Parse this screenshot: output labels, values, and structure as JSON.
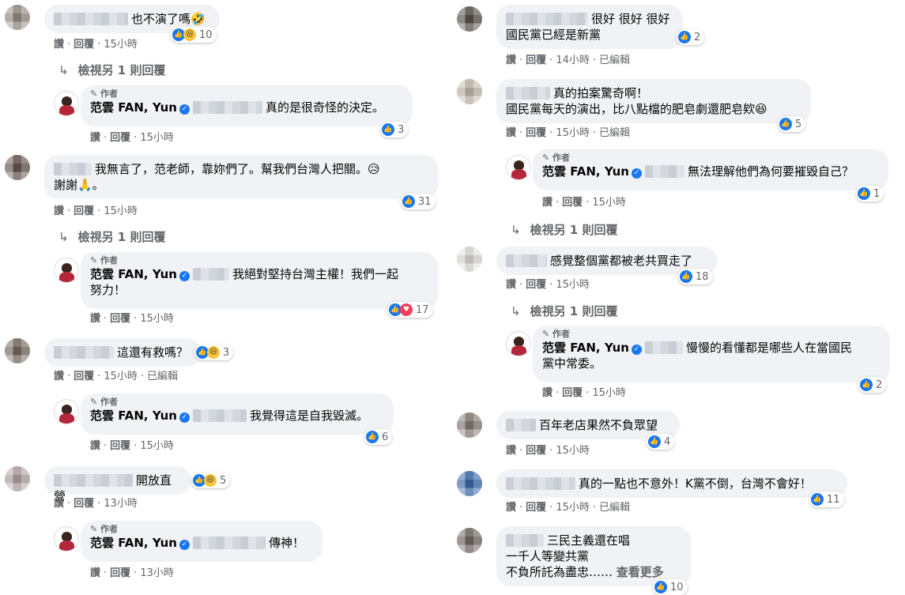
{
  "lbl": {
    "reply": "回覆",
    "like": "讚",
    "edited": "已編輯",
    "author": "作者",
    "fan": "范雲 FAN, Yun",
    "see_more": "查看更多",
    "see_more_reply": "檢視另 1 則回覆"
  },
  "left": [
    {
      "text": "也不演了嗎",
      "emoji": "🤣",
      "like": "讚",
      "reply": "回覆",
      "time": "15小時",
      "count": "10"
    },
    {
      "text": "真的是很奇怪的決定。",
      "time": "15小時",
      "count": "3"
    },
    {
      "text": "我無言了，范老師，靠妳們了。幫我們台灣人把關。😥",
      "text2": "謝謝🙏。",
      "time": "15小時",
      "count": "31"
    },
    {
      "text": "我絕對堅持台灣主權！我們一起",
      "text2": "努力！",
      "time": "15小時",
      "count": "17"
    },
    {
      "text": "這還有救嗎？",
      "time": "15小時",
      "count": "3"
    },
    {
      "text": "我覺得這是自我毀滅。",
      "time": "15小時",
      "count": "6"
    },
    {
      "text": "開放直營",
      "time": "13小時",
      "count": "5"
    },
    {
      "text": "傳神！",
      "time": "13小時"
    }
  ],
  "right": [
    {
      "text": "很好 很好 很好",
      "text2": "國民黨已經是新黨",
      "time": "14小時",
      "count": "2"
    },
    {
      "text": "真的拍案驚奇啊！",
      "text2": "國民黨每天的演出，比八點檔的肥皂劇還肥皂欸😆",
      "time": "15小時",
      "count": "5"
    },
    {
      "text": "無法理解他們為何要摧毀自己？",
      "time": "15小時",
      "count": "1"
    },
    {
      "text": "感覺整個黨都被老共買走了",
      "time": "15小時",
      "count": "18"
    },
    {
      "text": "慢慢的看懂都是哪些人在當國民",
      "text2": "黨中常委。",
      "time": "15小時",
      "count": "2"
    },
    {
      "text": "百年老店果然不負眾望",
      "time": "15小時",
      "count": "4"
    },
    {
      "text": "真的一點也不意外！K黨不倒，台灣不會好！",
      "time": "15小時",
      "count": "11"
    },
    {
      "text": "三民主義還在唱",
      "text2": "一千人等變共黨",
      "text3": "不負所託為盡忠……",
      "count": "10"
    }
  ]
}
